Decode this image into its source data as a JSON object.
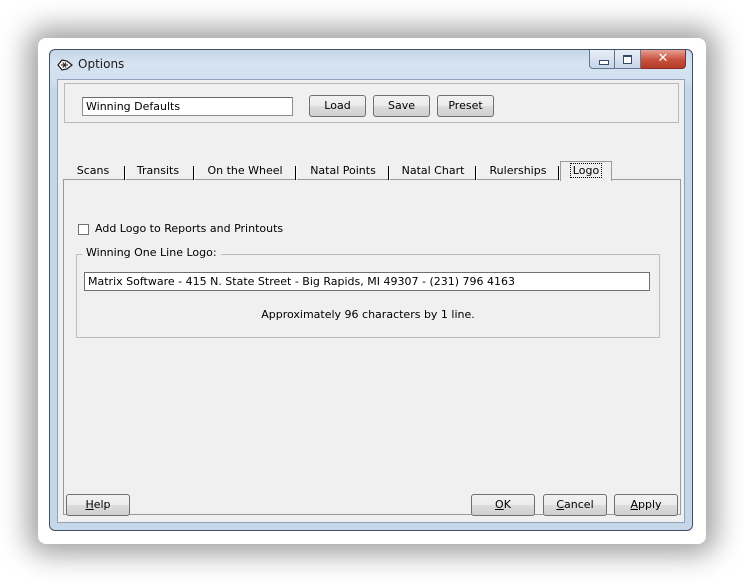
{
  "window": {
    "title": "Options",
    "close_glyph": "✕"
  },
  "preset": {
    "name_value": "Winning Defaults",
    "load_label": "Load",
    "save_label": "Save",
    "preset_label": "Preset"
  },
  "tabs": [
    {
      "label": "Scans"
    },
    {
      "label": "Transits"
    },
    {
      "label": "On the Wheel"
    },
    {
      "label": "Natal Points"
    },
    {
      "label": "Natal Chart"
    },
    {
      "label": "Rulerships"
    },
    {
      "label": "Logo",
      "active": true
    }
  ],
  "logo_tab": {
    "add_logo_label": "Add Logo to Reports and Printouts",
    "add_logo_checked": false,
    "group_label": "Winning One Line Logo:",
    "logo_text": "Matrix Software - 415 N. State Street - Big Rapids, MI 49307 - (231) 796 4163",
    "hint": "Approximately  96 characters by 1 line."
  },
  "buttons": {
    "help_underline": "H",
    "help_rest": "elp",
    "ok_underline": "O",
    "ok_rest": "K",
    "cancel_underline": "C",
    "cancel_rest": "ancel",
    "apply_underline": "A",
    "apply_rest": "pply"
  }
}
